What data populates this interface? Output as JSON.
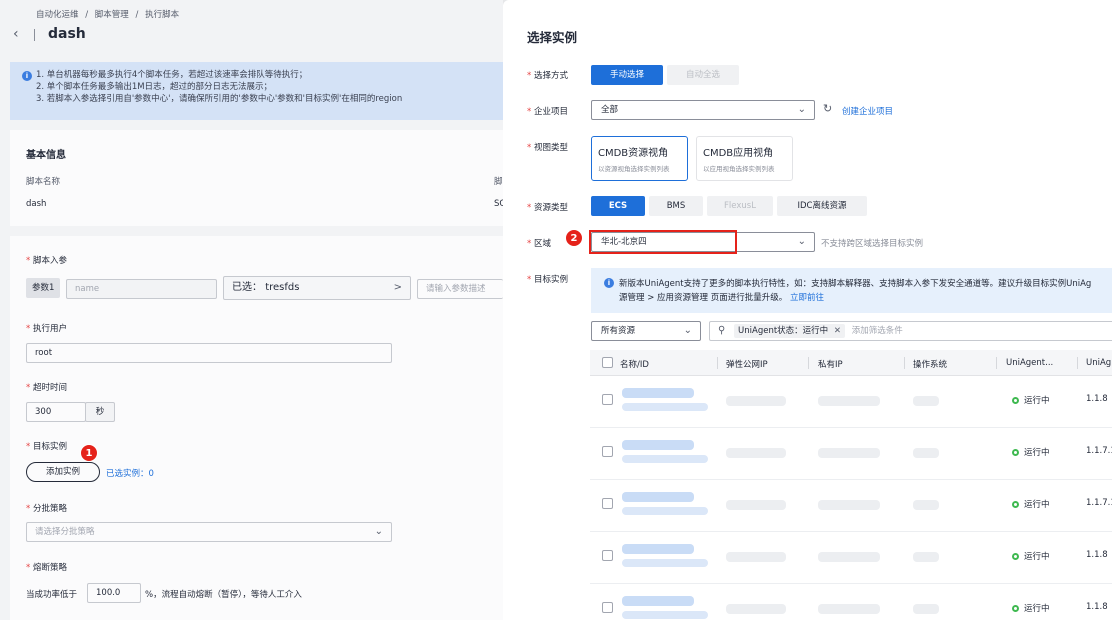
{
  "breadcrumb": [
    "自动化运维",
    "/",
    "脚本管理",
    "/",
    "执行脚本"
  ],
  "page_title": "dash",
  "notice_lines": [
    "1. 单台机器每秒最多执行4个脚本任务，若超过该速率会排队等待执行；",
    "2. 单个脚本任务最多输出1M日志，超过的部分日志无法展示；",
    "3. 若脚本入参选择引用自'参数中心'，请确保所引用的'参数中心'参数和'目标实例'在相同的region"
  ],
  "basic_info": {
    "title": "基本信息",
    "script_name_label": "脚本名称",
    "script_name_value": "dash",
    "col2_label": "脚",
    "col2_value": "SC"
  },
  "form": {
    "params_label": "脚本入参",
    "param1_tag": "参数1",
    "name_placeholder": "name",
    "selected_prefix": "已选：",
    "selected_value": "tresfds",
    "selected_arrow": ">",
    "param_desc_placeholder": "请输入参数描述",
    "exec_user_label": "执行用户",
    "exec_user_value": "root",
    "timeout_label": "超时时间",
    "timeout_value": "300",
    "timeout_unit": "秒",
    "target_label": "目标实例",
    "add_instance_button": "添加实例",
    "selected_count": "已选实例：0",
    "marker1": "1",
    "batch_label": "分批策略",
    "batch_placeholder": "请选择分批策略",
    "circuit_label": "熔断策略",
    "circuit_prefix": "当成功率低于",
    "circuit_value": "100.0",
    "circuit_suffix": "%，流程自动熔断（暂停），等待人工介入"
  },
  "drawer": {
    "title": "选择实例",
    "mode_label": "选择方式",
    "mode_manual": "手动选择",
    "mode_auto": "自动全选",
    "project_label": "企业项目",
    "project_value": "全部",
    "create_project_link": "创建企业项目",
    "view_label": "视图类型",
    "view_cmdb_resource_title": "CMDB资源视角",
    "view_cmdb_resource_sub": "以资源视角选择实例列表",
    "view_cmdb_app_title": "CMDB应用视角",
    "view_cmdb_app_sub": "以应用视角选择实例列表",
    "resource_label": "资源类型",
    "resource_types": [
      "ECS",
      "BMS",
      "FlexusL",
      "IDC离线资源"
    ],
    "region_label": "区域",
    "region_value": "华北-北京四",
    "region_hint": "不支持跨区域选择目标实例",
    "marker2": "2",
    "target_label": "目标实例",
    "banner_line1": "新版本UniAgent支持了更多的脚本执行特性，如：支持脚本解释器、支持脚本入参下发安全通道等。建议升级目标实例UniAg",
    "banner_line2_prefix": "源管理 > 应用资源管理 页面进行批量升级。",
    "banner_link": "立即前往",
    "filter_select": "所有资源",
    "filter_chip": "UniAgent状态：运行中",
    "filter_placeholder": "添加筛选条件",
    "columns": [
      "名称/ID",
      "弹性公网IP",
      "私有IP",
      "操作系统",
      "UniAgent...",
      "UniAg"
    ],
    "rows": [
      {
        "status": "运行中",
        "version": "1.1.8"
      },
      {
        "status": "运行中",
        "version": "1.1.7.1"
      },
      {
        "status": "运行中",
        "version": "1.1.7.1"
      },
      {
        "status": "运行中",
        "version": "1.1.8"
      },
      {
        "status": "运行中",
        "version": "1.1.8"
      }
    ]
  },
  "colors": {
    "primary": "#1e6fd9",
    "required": "#e54545",
    "marker": "#e5221a",
    "running": "#3fb950"
  }
}
